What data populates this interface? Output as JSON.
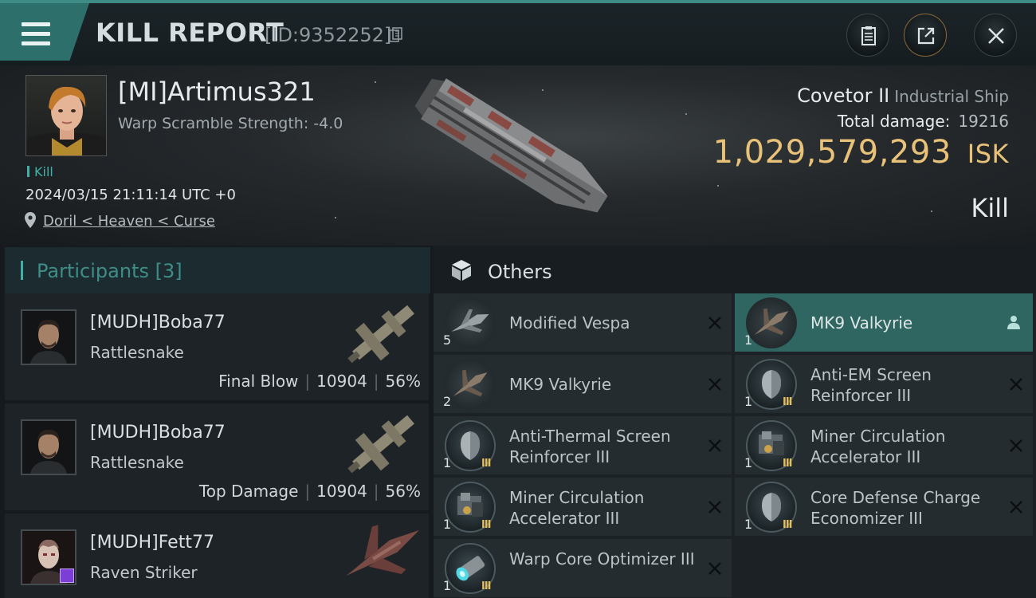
{
  "header": {
    "title": "KILL REPORT",
    "report_id": "[ID:9352252]",
    "icons": [
      "menu-icon",
      "copy-icon",
      "clipboard-icon",
      "share-icon",
      "close-icon"
    ]
  },
  "victim": {
    "name": "[MI]Artimus321",
    "warp_scramble": "Warp Scramble Strength: -4.0",
    "tag": "Kill",
    "time": "2024/03/15 21:11:14 UTC +0",
    "location": "Doril < Heaven < Curse",
    "ship": "Covetor II",
    "ship_class": "Industrial Ship",
    "total_damage_label": "Total damage:",
    "total_damage": "19216",
    "isk_value": "1,029,579,293",
    "isk_unit": "ISK",
    "result": "Kill"
  },
  "participants": {
    "label": "Participants [3]",
    "list": [
      {
        "name": "[MUDH]Boba77",
        "ship": "Rattlesnake",
        "role": "Final Blow",
        "damage": "10904",
        "percent": "56%"
      },
      {
        "name": "[MUDH]Boba77",
        "ship": "Rattlesnake",
        "role": "Top Damage",
        "damage": "10904",
        "percent": "56%"
      },
      {
        "name": "[MUDH]Fett77",
        "ship": "Raven Striker"
      }
    ]
  },
  "others": {
    "label": "Others",
    "items": [
      {
        "name": "Modified Vespa",
        "qty": "5"
      },
      {
        "name": "MK9  Valkyrie",
        "qty": "1"
      },
      {
        "name": "MK9  Valkyrie",
        "qty": "2"
      },
      {
        "name": "Anti-EM Screen Reinforcer III",
        "qty": "1",
        "meta": "III"
      },
      {
        "name": "Anti-Thermal Screen Reinforcer III",
        "qty": "1",
        "meta": "III"
      },
      {
        "name": "Miner Circulation Accelerator III",
        "qty": "1",
        "meta": "III"
      },
      {
        "name": "Miner Circulation Accelerator III",
        "qty": "1",
        "meta": "III"
      },
      {
        "name": "Core Defense Charge Economizer III",
        "qty": "1",
        "meta": "III"
      },
      {
        "name": "Warp Core Optimizer III",
        "qty": "1",
        "meta": "III"
      }
    ]
  },
  "colors": {
    "accent": "#3fb1a7",
    "isk": "#e9c27a",
    "selected": "#2f6661",
    "meta_gold": "#e5c058"
  }
}
